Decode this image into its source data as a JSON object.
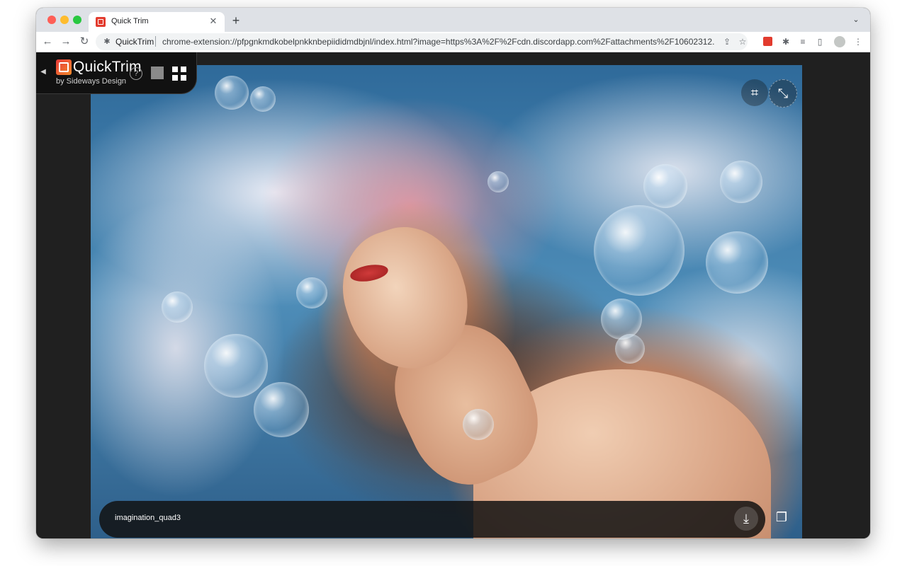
{
  "browser": {
    "tab": {
      "title": "Quick Trim",
      "favicon": "quicktrim-favicon",
      "close_glyph": "✕"
    },
    "new_tab_glyph": "+",
    "tab_dropdown_glyph": "⌄",
    "nav": {
      "back_glyph": "←",
      "forward_glyph": "→",
      "reload_glyph": "↻"
    },
    "omnibox": {
      "site_label": "QuickTrim",
      "url": "chrome-extension://pfpgnkmdkobelpnkknbepiididmdbjnl/index.html?image=https%3A%2F%2Fcdn.discordapp.com%2Fattachments%2F10602312..."
    },
    "toolbar_icons": [
      "share-icon",
      "bookmark-star-icon",
      "quicktrim-extension-icon",
      "extensions-puzzle-icon",
      "media-control-icon",
      "side-panel-icon",
      "profile-avatar",
      "menu-dots-icon"
    ]
  },
  "quicktrim": {
    "title": "QuickTrim",
    "byline": "by Sideways Design",
    "help_glyph": "?",
    "collapse_glyph": "◀"
  },
  "viewer": {
    "filename": "imagination_quad3",
    "crop_glyph": "⌗",
    "shrink_glyph": "⤡",
    "download_glyph": "⤓",
    "copy_glyph": "❐"
  },
  "colors": {
    "window_bg": "#202020",
    "tabstrip_bg": "#dee1e6",
    "brand_red": "#e23b2e",
    "brand_orange": "#f28a2a"
  }
}
